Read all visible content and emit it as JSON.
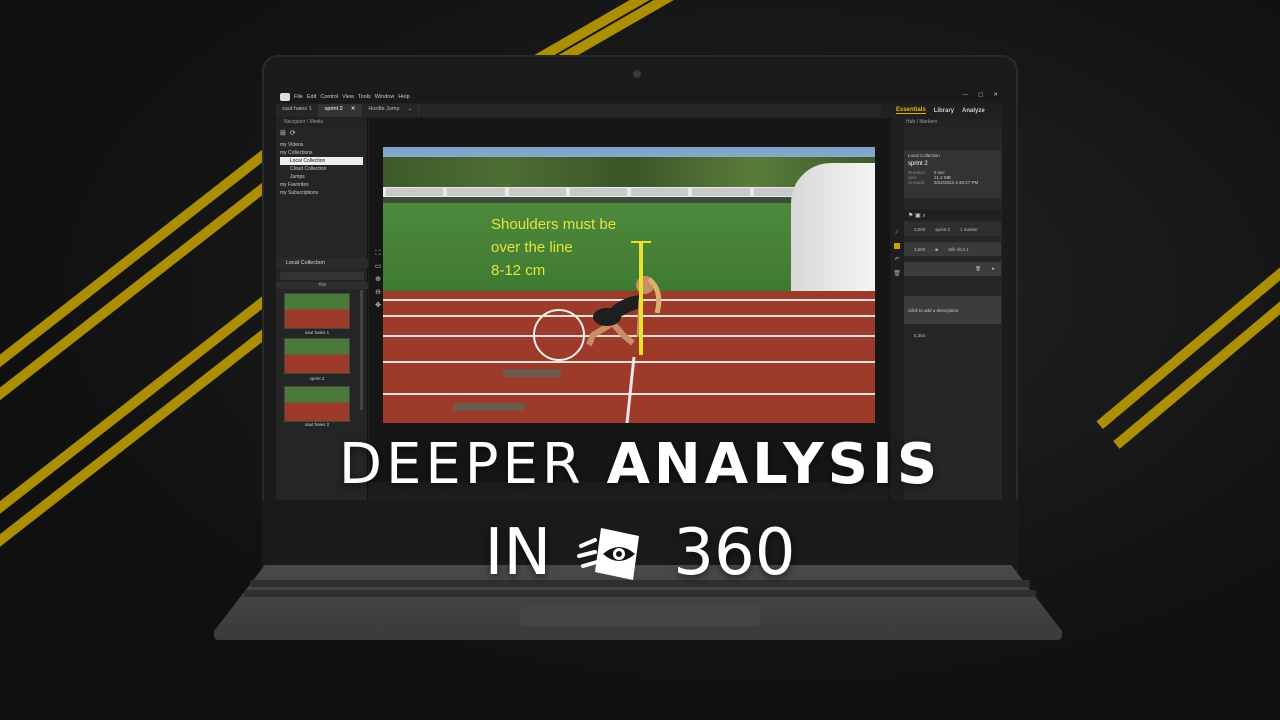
{
  "app": {
    "menu": [
      "File",
      "Edit",
      "Control",
      "View",
      "Tools",
      "Window",
      "Help"
    ],
    "window_controls": [
      "—",
      "▢",
      "✕"
    ],
    "tabs": [
      {
        "label": "saut haies 1",
        "active": false
      },
      {
        "label": "sprint 2",
        "active": true
      },
      {
        "label": "Hurdle Jump",
        "active": false
      }
    ],
    "panel_tabs": [
      {
        "label": "Essentials",
        "active": true
      },
      {
        "label": "Library",
        "active": false
      },
      {
        "label": "Analyze",
        "active": false
      }
    ]
  },
  "navigator": {
    "header": "Navigator / Media",
    "tree": [
      {
        "label": "my Videos",
        "selected": false
      },
      {
        "label": "my Collections",
        "selected": false
      },
      {
        "label": "Local Collection",
        "selected": true
      },
      {
        "label": "Cloud Collection",
        "selected": false
      },
      {
        "label": "Jumps",
        "selected": false
      },
      {
        "label": "my Favorites",
        "selected": false
      },
      {
        "label": "my Subscriptions",
        "selected": false
      }
    ]
  },
  "collection": {
    "title": "Local Collection",
    "column_header": "Title",
    "items": [
      {
        "label": "saut haies 1"
      },
      {
        "label": "sprint 2"
      },
      {
        "label": "saut haies 2"
      }
    ]
  },
  "viewer": {
    "annotation_lines": [
      "Shoulders must be",
      "over the line",
      "8-12 cm"
    ]
  },
  "hub": {
    "header": "Hub / Markers",
    "info": {
      "collection": "Local Collection",
      "title": "sprint 2",
      "fields": [
        {
          "key": "Duration",
          "value": "5 sec"
        },
        {
          "key": "Size",
          "value": "21.2 MB"
        },
        {
          "key": "Created",
          "value": "5/22/2023 4:48:27 PM"
        }
      ]
    },
    "markers": [
      {
        "time": "0,000",
        "title": "sprint 2",
        "sub": "1 marker"
      },
      {
        "time": "3,680",
        "title": "Still shot 1",
        "sub": ""
      },
      {
        "time": "5,264",
        "title": "",
        "sub": ""
      }
    ],
    "description_placeholder": "Click to add a description"
  },
  "headline": {
    "light": "DEEPER",
    "bold": "ANALYSIS",
    "second_prefix": "IN",
    "second_suffix": "360"
  },
  "colors": {
    "accent": "#e4b800",
    "annotation": "#e7e23a",
    "background": "#141414"
  }
}
